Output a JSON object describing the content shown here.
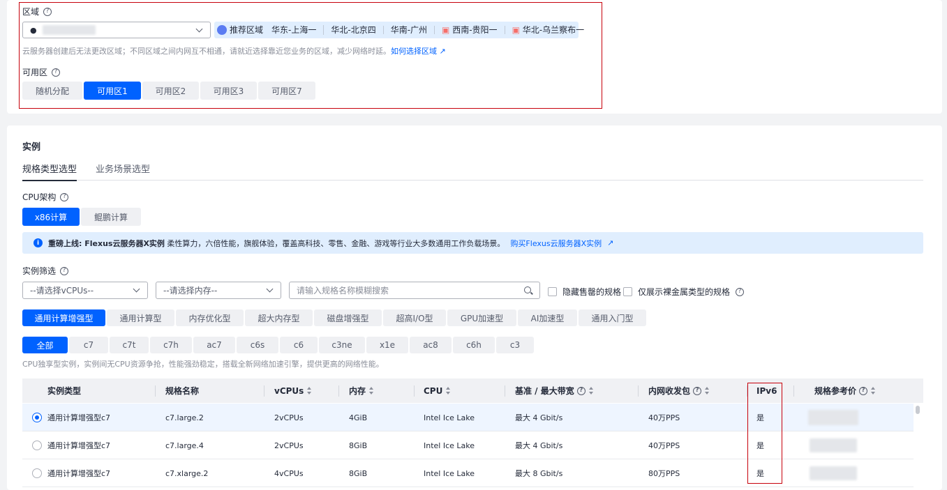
{
  "region": {
    "label": "区域",
    "selected_value": "",
    "recommended_label": "推荐区域",
    "recommended": [
      "华东-上海一",
      "华北-北京四",
      "华南-广州",
      "西南-贵阳一",
      "华北-乌兰察布一"
    ],
    "hint": "云服务器创建后无法更改区域；不同区域之间内网互不相通，请就近选择靠近您业务的区域，减少网络时延。",
    "hint_link": "如何选择区域"
  },
  "az": {
    "label": "可用区",
    "options": [
      "随机分配",
      "可用区1",
      "可用区2",
      "可用区3",
      "可用区7"
    ],
    "selected": "可用区1"
  },
  "instance": {
    "title": "实例",
    "tabs": [
      "规格类型选型",
      "业务场景选型"
    ],
    "cpu_arch_label": "CPU架构",
    "cpu_arch": [
      "x86计算",
      "鲲鹏计算"
    ],
    "notice_bold": "重磅上线: Flexus云服务器X实例",
    "notice_text": " 柔性算力，六倍性能，旗舰体验，覆盖高科技、零售、金融、游戏等行业大多数通用工作负载场景。",
    "notice_link": "购买Flexus云服务器X实例",
    "filter_label": "实例筛选",
    "vcpu_placeholder": "--请选择vCPUs--",
    "mem_placeholder": "--请选择内存--",
    "search_placeholder": "请输入规格名称模糊搜索",
    "hide_soldout": "隐藏售罄的规格",
    "baremetal_only": "仅展示裸金属类型的规格",
    "types": [
      "通用计算增强型",
      "通用计算型",
      "内存优化型",
      "超大内存型",
      "磁盘增强型",
      "超高I/O型",
      "GPU加速型",
      "AI加速型",
      "通用入门型"
    ],
    "families": [
      "全部",
      "c7",
      "c7t",
      "c7h",
      "ac7",
      "c6s",
      "c6",
      "c3ne",
      "x1e",
      "ac8",
      "c6h",
      "c3"
    ],
    "family_desc": "CPU独享型实例，实例间无CPU资源争抢，性能强劲稳定，搭载全新网络加速引擎，提供更高的网络性能。"
  },
  "table": {
    "headers": [
      "实例类型",
      "规格名称",
      "vCPUs",
      "内存",
      "CPU",
      "基准 / 最大带宽",
      "内网收发包",
      "IPv6",
      "规格参考价"
    ],
    "rows": [
      [
        "通用计算增强型c7",
        "c7.large.2",
        "2vCPUs",
        "4GiB",
        "Intel Ice Lake",
        "最大 4 Gbit/s",
        "40万PPS",
        "是"
      ],
      [
        "通用计算增强型c7",
        "c7.large.4",
        "2vCPUs",
        "8GiB",
        "Intel Ice Lake",
        "最大 4 Gbit/s",
        "40万PPS",
        "是"
      ],
      [
        "通用计算增强型c7",
        "c7.xlarge.2",
        "4vCPUs",
        "8GiB",
        "Intel Ice Lake",
        "最大 8 Gbit/s",
        "80万PPS",
        "是"
      ]
    ],
    "selected_row": 0
  },
  "colors": {
    "primary": "#0062ff",
    "highlight": "#c7000b",
    "notice_bg": "#e0eefe"
  }
}
